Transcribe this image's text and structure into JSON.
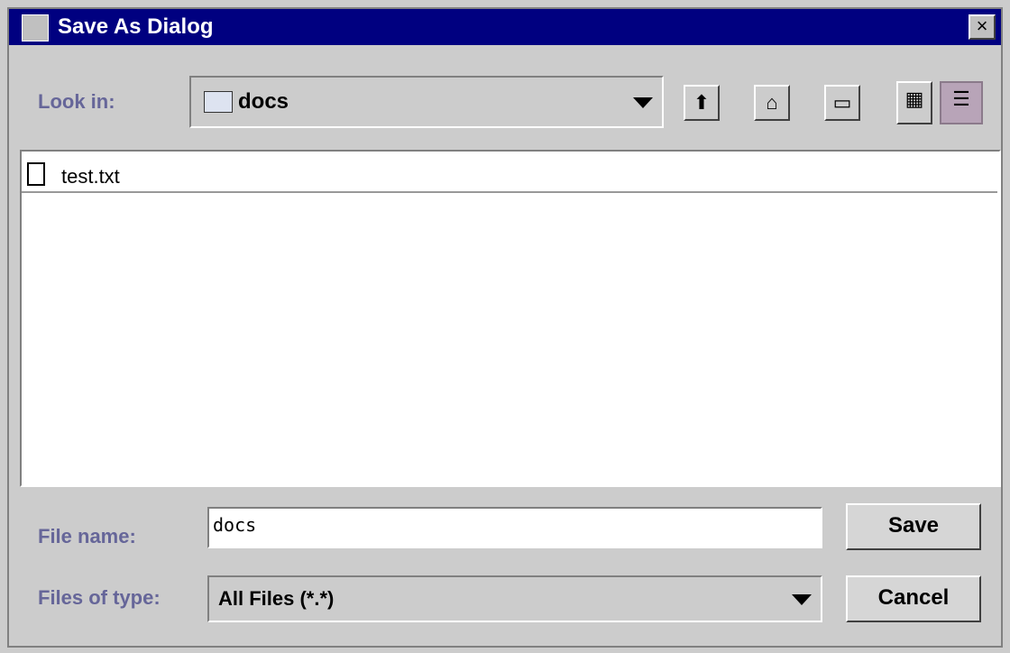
{
  "window": {
    "title": "Save As Dialog",
    "close_glyph": "×"
  },
  "look_in": {
    "label": "Look in:",
    "value": "docs",
    "icon": "folder-icon"
  },
  "toolbar": {
    "up_icon": "up-folder-icon",
    "home_icon": "home-icon",
    "new_folder_icon": "new-folder-icon",
    "list_view_icon": "list-view-icon",
    "details_view_icon": "details-view-icon"
  },
  "files": [
    {
      "name": "test.txt",
      "icon": "file-icon"
    }
  ],
  "file_name": {
    "label": "File name:",
    "value": "docs"
  },
  "file_type": {
    "label": "Files of type:",
    "value": "All Files (*.*)"
  },
  "buttons": {
    "save": "Save",
    "cancel": "Cancel"
  },
  "colors": {
    "titlebar": "#000080",
    "label": "#666699",
    "pressed": "#b8a4b8"
  }
}
